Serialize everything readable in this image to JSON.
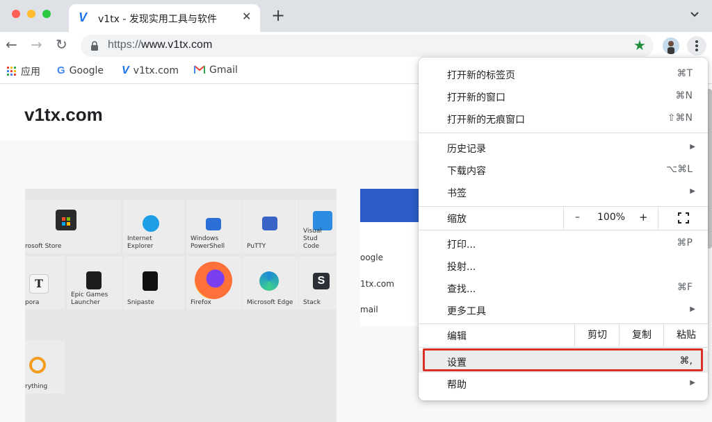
{
  "window": {
    "traffic_colors": [
      "#ff5f57",
      "#febc2e",
      "#28c840"
    ]
  },
  "tab": {
    "logo": "V",
    "title": "v1tx - 发现实用工具与软件",
    "close": "✕",
    "new_tab": "+",
    "chevron": "⌄"
  },
  "toolbar": {
    "back": "←",
    "forward": "→",
    "reload": "↻",
    "url_scheme": "https://",
    "url_host": "www.v1tx.com",
    "star": "★"
  },
  "bookmarks": [
    {
      "label": "应用",
      "icon": "apps-grid-icon"
    },
    {
      "label": "Google",
      "icon": "google-g-icon"
    },
    {
      "label": "v1tx.com",
      "icon": "v1tx-logo-icon"
    },
    {
      "label": "Gmail",
      "icon": "gmail-icon"
    }
  ],
  "page": {
    "site_title": "v1tx.com",
    "tiles": [
      {
        "label": "rosoft Store",
        "color": "#2b2b2b",
        "icon": "store-bag-icon"
      },
      {
        "label": "Internet\nExplorer",
        "color": "#1f9ee8",
        "icon": "ie-icon"
      },
      {
        "label": "Windows\nPowerShell",
        "color": "#2c6fd6",
        "icon": "powershell-icon"
      },
      {
        "label": "PuTTY",
        "color": "#3a63c8",
        "icon": "putty-icon"
      },
      {
        "label": "Visual Stud\nCode",
        "color": "#2a8be0",
        "icon": "vscode-icon"
      },
      {
        "label": "pora",
        "color": "#f4f4f4",
        "icon": "typora-icon"
      },
      {
        "label": "Epic Games\nLauncher",
        "color": "#1d1d1d",
        "icon": "epic-games-icon"
      },
      {
        "label": "Snipaste",
        "color": "#111111",
        "icon": "snipaste-icon"
      },
      {
        "label": "Firefox",
        "color": "#ff7139",
        "icon": "firefox-icon"
      },
      {
        "label": "Microsoft Edge",
        "color": "#1d8ad6",
        "icon": "edge-icon"
      },
      {
        "label": "Stack",
        "color": "#2b2f36",
        "icon": "stack-icon"
      },
      {
        "label": "rything",
        "color": "#f39c1f",
        "icon": "everything-icon"
      }
    ],
    "card_items": [
      "oogle",
      "1tx.com",
      "mail"
    ]
  },
  "menu": {
    "group1": [
      {
        "label": "打开新的标签页",
        "shortcut": "⌘T"
      },
      {
        "label": "打开新的窗口",
        "shortcut": "⌘N"
      },
      {
        "label": "打开新的无痕窗口",
        "shortcut": "⇧⌘N"
      }
    ],
    "group2": [
      {
        "label": "历史记录",
        "shortcut": ""
      },
      {
        "label": "下载内容",
        "shortcut": "⌥⌘L"
      },
      {
        "label": "书签",
        "shortcut": ""
      }
    ],
    "zoom": {
      "label": "缩放",
      "minus": "–",
      "value": "100%",
      "plus": "+"
    },
    "group3": [
      {
        "label": "打印...",
        "shortcut": "⌘P"
      },
      {
        "label": "投射...",
        "shortcut": ""
      },
      {
        "label": "查找...",
        "shortcut": "⌘F"
      },
      {
        "label": "更多工具",
        "shortcut": ""
      }
    ],
    "edit": {
      "label": "编辑",
      "cut": "剪切",
      "copy": "复制",
      "paste": "粘贴"
    },
    "settings": {
      "label": "设置",
      "shortcut": "⌘,"
    },
    "help": {
      "label": "帮助"
    },
    "submenu_arrow": "▶",
    "highlight_color": "#d93025"
  }
}
